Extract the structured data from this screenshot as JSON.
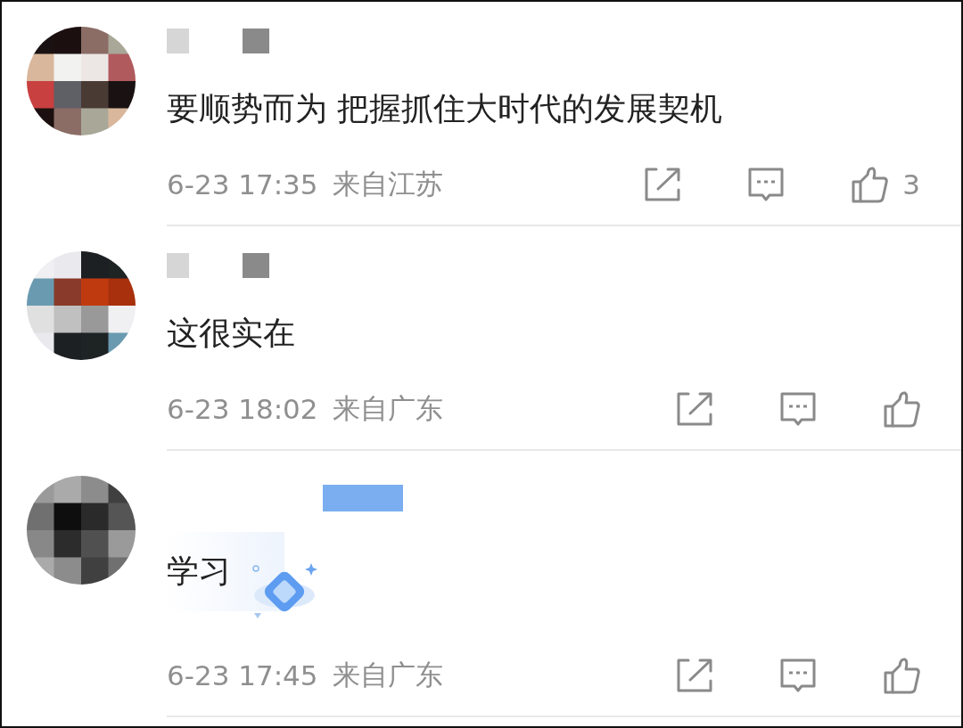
{
  "comments": [
    {
      "text": "要顺势而为 把握抓住大时代的发展契机",
      "time": "6-23 17:35",
      "location": "来自江苏",
      "likes": "3",
      "sticker": false
    },
    {
      "text": "这很实在",
      "time": "6-23 18:02",
      "location": "来自广东",
      "sticker": false
    },
    {
      "text": "学习",
      "time": "6-23 17:45",
      "location": "来自广东",
      "sticker": true
    }
  ]
}
